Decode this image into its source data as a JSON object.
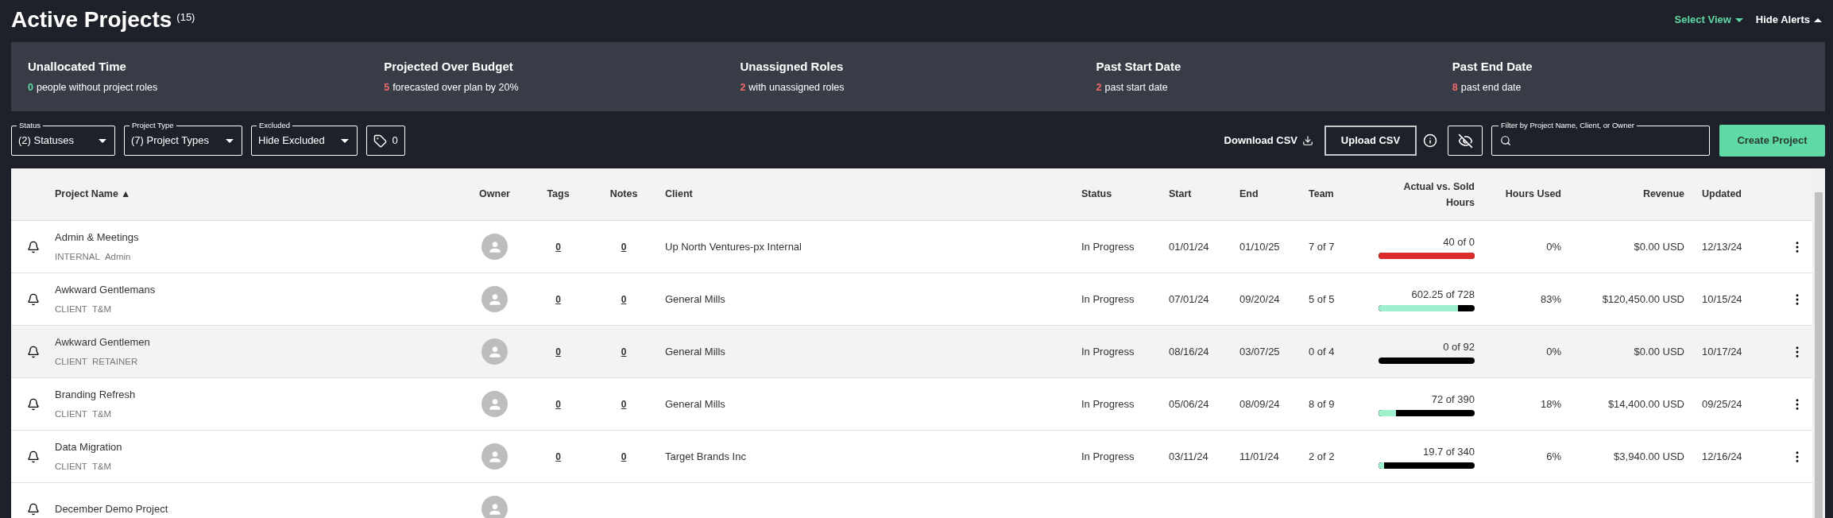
{
  "page": {
    "title": "Active Projects",
    "count": "(15)",
    "select_view": "Select View",
    "hide_alerts": "Hide Alerts"
  },
  "alerts": [
    {
      "title": "Unallocated Time",
      "count": "0",
      "text": "people without project roles",
      "color": "#5fd9a5"
    },
    {
      "title": "Projected Over Budget",
      "count": "5",
      "text": "forecasted over plan by 20%",
      "color": "#f26b6b"
    },
    {
      "title": "Unassigned Roles",
      "count": "2",
      "text": "with unassigned roles",
      "color": "#f26b6b"
    },
    {
      "title": "Past Start Date",
      "count": "2",
      "text": "past start date",
      "color": "#f26b6b"
    },
    {
      "title": "Past End Date",
      "count": "8",
      "text": "past end date",
      "color": "#f26b6b"
    }
  ],
  "filters": [
    {
      "label": "Status",
      "value": "(2) Statuses"
    },
    {
      "label": "Project Type",
      "value": "(7) Project Types"
    },
    {
      "label": "Excluded",
      "value": "Hide Excluded"
    }
  ],
  "tag_filter": {
    "count": "0"
  },
  "toolbar": {
    "download": "Download CSV",
    "upload": "Upload CSV",
    "search_label": "Filter by Project Name, Client, or Owner",
    "create": "Create Project"
  },
  "table": {
    "columns": [
      {
        "label": "Project Name",
        "sort": "▲"
      },
      {
        "label": "Owner"
      },
      {
        "label": "Tags"
      },
      {
        "label": "Notes"
      },
      {
        "label": "Client"
      },
      {
        "label": "Status"
      },
      {
        "label": "Start"
      },
      {
        "label": "End"
      },
      {
        "label": "Team"
      },
      {
        "label": "Actual vs. Sold Hours"
      },
      {
        "label": "Hours Used"
      },
      {
        "label": "Revenue"
      },
      {
        "label": "Updated"
      }
    ],
    "rows": [
      {
        "name": "Admin & Meetings",
        "type": "INTERNAL",
        "billing": "Admin",
        "tags": "0",
        "notes": "0",
        "client": "Up North Ventures-px Internal",
        "status": "In Progress",
        "start": "01/01/24",
        "end": "01/10/25",
        "team": "7 of 7",
        "hours": "40 of 0",
        "level": 1,
        "over_budget": true,
        "hours_used": "0%",
        "revenue": "$0.00 USD",
        "updated": "12/13/24",
        "highlighted": false
      },
      {
        "name": "Awkward Gentlemans",
        "type": "CLIENT",
        "billing": "T&M",
        "tags": "0",
        "notes": "0",
        "client": "General Mills",
        "status": "In Progress",
        "start": "07/01/24",
        "end": "09/20/24",
        "team": "5 of 5",
        "hours": "602.25 of 728",
        "level": 0.83,
        "over_budget": false,
        "hours_used": "83%",
        "revenue": "$120,450.00 USD",
        "updated": "10/15/24",
        "highlighted": false
      },
      {
        "name": "Awkward Gentlemen",
        "type": "CLIENT",
        "billing": "RETAINER",
        "tags": "0",
        "notes": "0",
        "client": "General Mills",
        "status": "In Progress",
        "start": "08/16/24",
        "end": "03/07/25",
        "team": "0 of 4",
        "hours": "0 of 92",
        "level": 0,
        "over_budget": false,
        "hours_used": "0%",
        "revenue": "$0.00 USD",
        "updated": "10/17/24",
        "highlighted": true
      },
      {
        "name": "Branding Refresh",
        "type": "CLIENT",
        "billing": "T&M",
        "tags": "0",
        "notes": "0",
        "client": "General Mills",
        "status": "In Progress",
        "start": "05/06/24",
        "end": "08/09/24",
        "team": "8 of 9",
        "hours": "72 of 390",
        "level": 0.18,
        "over_budget": false,
        "hours_used": "18%",
        "revenue": "$14,400.00 USD",
        "updated": "09/25/24",
        "highlighted": false
      },
      {
        "name": "Data Migration",
        "type": "CLIENT",
        "billing": "T&M",
        "tags": "0",
        "notes": "0",
        "client": "Target Brands Inc",
        "status": "In Progress",
        "start": "03/11/24",
        "end": "11/01/24",
        "team": "2 of 2",
        "hours": "19.7 of 340",
        "level": 0.06,
        "over_budget": false,
        "hours_used": "6%",
        "revenue": "$3,940.00 USD",
        "updated": "12/16/24",
        "highlighted": false
      },
      {
        "name": "December Demo Project",
        "highlighted": false
      }
    ]
  }
}
